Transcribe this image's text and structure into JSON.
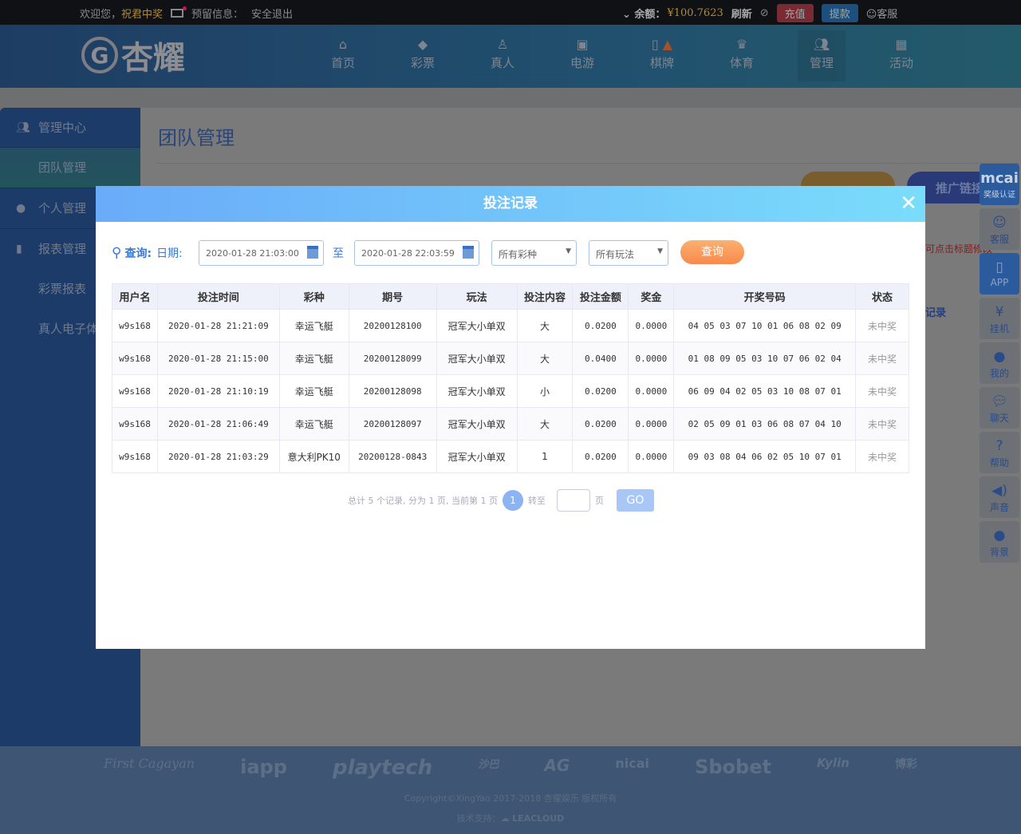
{
  "topbar": {
    "welcome": "欢迎您，",
    "username": "祝君中奖",
    "reserved": "预留信息：",
    "logout": "安全退出",
    "balance_label": "余额：",
    "balance": "¥100.7623",
    "refresh": "刷新",
    "deposit": "充值",
    "withdraw": "提款",
    "service": "客服"
  },
  "logo": "杏耀",
  "nav": [
    {
      "label": "首页",
      "icon": "home-icon"
    },
    {
      "label": "彩票",
      "icon": "lottery-icon"
    },
    {
      "label": "真人",
      "icon": "dealer-icon"
    },
    {
      "label": "电游",
      "icon": "slot-icon"
    },
    {
      "label": "棋牌",
      "icon": "mahjong-icon"
    },
    {
      "label": "体育",
      "icon": "trophy-icon"
    },
    {
      "label": "管理",
      "icon": "users-icon"
    },
    {
      "label": "活动",
      "icon": "gift-icon"
    }
  ],
  "sidebar": {
    "items": [
      {
        "label": "管理中心"
      },
      {
        "label": "团队管理"
      },
      {
        "label": "个人管理"
      },
      {
        "label": "报表管理"
      },
      {
        "label": "彩票报表"
      },
      {
        "label": "真人电子体"
      }
    ]
  },
  "page": {
    "title": "团队管理",
    "promo_link": "推广链接",
    "hint": "可点击标题修改",
    "record": "记录"
  },
  "float": [
    {
      "label": "奖级认证",
      "brand": "mcai"
    },
    {
      "label": "客服"
    },
    {
      "label": "APP"
    },
    {
      "label": "挂机"
    },
    {
      "label": "我的"
    },
    {
      "label": "聊天"
    },
    {
      "label": "帮助"
    },
    {
      "label": "声音"
    },
    {
      "label": "背景"
    }
  ],
  "modal": {
    "title": "投注记录",
    "query_label": "查询:",
    "date_label": "日期:",
    "date_from": "2020-01-28 21:03:00",
    "to": "至",
    "date_to": "2020-01-28 22:03:59",
    "lottery_select": "所有彩种",
    "play_select": "所有玩法",
    "query_button": "查询",
    "columns": [
      "用户名",
      "投注时间",
      "彩种",
      "期号",
      "玩法",
      "投注内容",
      "投注金额",
      "奖金",
      "开奖号码",
      "状态"
    ],
    "rows": [
      [
        "w9s168",
        "2020-01-28 21:21:09",
        "幸运飞艇",
        "20200128100",
        "冠军大小单双",
        "大",
        "0.0200",
        "0.0000",
        "04 05 03 07 10 01 06 08 02 09",
        "未中奖"
      ],
      [
        "w9s168",
        "2020-01-28 21:15:00",
        "幸运飞艇",
        "20200128099",
        "冠军大小单双",
        "大",
        "0.0400",
        "0.0000",
        "01 08 09 05 03 10 07 06 02 04",
        "未中奖"
      ],
      [
        "w9s168",
        "2020-01-28 21:10:19",
        "幸运飞艇",
        "20200128098",
        "冠军大小单双",
        "小",
        "0.0200",
        "0.0000",
        "06 09 04 02 05 03 10 08 07 01",
        "未中奖"
      ],
      [
        "w9s168",
        "2020-01-28 21:06:49",
        "幸运飞艇",
        "20200128097",
        "冠军大小单双",
        "大",
        "0.0200",
        "0.0000",
        "02 05 09 01 03 06 08 07 04 10",
        "未中奖"
      ],
      [
        "w9s168",
        "2020-01-28 21:03:29",
        "意大利PK10",
        "20200128-0843",
        "冠军大小单双",
        "1",
        "0.0200",
        "0.0000",
        "09 03 08 04 06 02 05 10 07 01",
        "未中奖"
      ]
    ],
    "pager": {
      "summary": "总计 5 个记录, 分为 1 页, 当前第 1 页",
      "current": "1",
      "goto": "转至",
      "page": "页",
      "go": "GO"
    }
  },
  "footer": {
    "logos": [
      "First Cagayan",
      "iapp",
      "playtech",
      "沙巴",
      "AG",
      "nicai",
      "Sbobet",
      "Kylin",
      "博彩"
    ],
    "copyright": "Copyright©XingYao 2017-2018 杏耀娱乐 版权所有",
    "tech": "技术支持：",
    "tech_brand": "LEACLOUD"
  }
}
